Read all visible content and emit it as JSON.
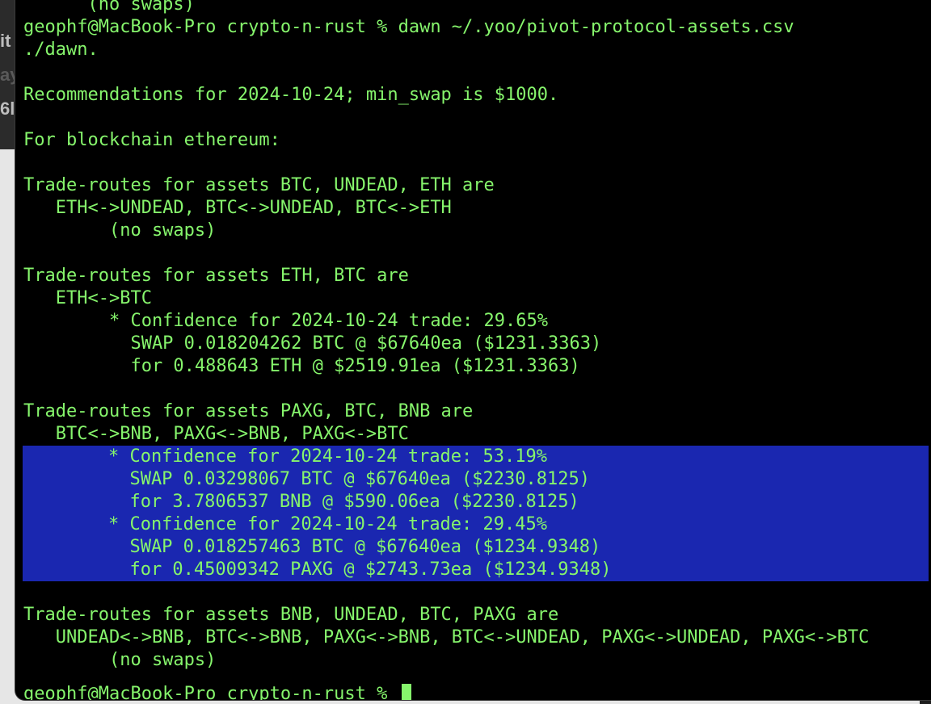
{
  "background": {
    "fragments": [
      "it",
      "ay",
      "6l"
    ],
    "colors": {
      "desktop": "#e6e6e6",
      "dark_strip": "#2b2b2b"
    }
  },
  "terminal": {
    "colors": {
      "background": "#000000",
      "text": "#86f56c",
      "selection": "#1a27b0"
    },
    "prompt": "geophf@MacBook-Pro crypto-n-rust % ",
    "lines": [
      {
        "text": "      (no swaps)",
        "highlighted": false
      },
      {
        "text": "geophf@MacBook-Pro crypto-n-rust % dawn ~/.yoo/pivot-protocol-assets.csv",
        "highlighted": false
      },
      {
        "text": "./dawn.",
        "highlighted": false
      },
      {
        "text": "",
        "highlighted": false
      },
      {
        "text": "Recommendations for 2024-10-24; min_swap is $1000.",
        "highlighted": false
      },
      {
        "text": "",
        "highlighted": false
      },
      {
        "text": "For blockchain ethereum:",
        "highlighted": false
      },
      {
        "text": "",
        "highlighted": false
      },
      {
        "text": "Trade-routes for assets BTC, UNDEAD, ETH are",
        "highlighted": false
      },
      {
        "text": "   ETH<->UNDEAD, BTC<->UNDEAD, BTC<->ETH",
        "highlighted": false
      },
      {
        "text": "        (no swaps)",
        "highlighted": false
      },
      {
        "text": "",
        "highlighted": false
      },
      {
        "text": "Trade-routes for assets ETH, BTC are",
        "highlighted": false
      },
      {
        "text": "   ETH<->BTC",
        "highlighted": false
      },
      {
        "text": "        * Confidence for 2024-10-24 trade: 29.65%",
        "highlighted": false
      },
      {
        "text": "          SWAP 0.018204262 BTC @ $67640ea ($1231.3363)",
        "highlighted": false
      },
      {
        "text": "          for 0.488643 ETH @ $2519.91ea ($1231.3363)",
        "highlighted": false
      },
      {
        "text": "",
        "highlighted": false
      },
      {
        "text": "Trade-routes for assets PAXG, BTC, BNB are",
        "highlighted": false
      },
      {
        "text": "   BTC<->BNB, PAXG<->BNB, PAXG<->BTC",
        "highlighted": false
      },
      {
        "text": "        * Confidence for 2024-10-24 trade: 53.19%",
        "highlighted": true
      },
      {
        "text": "          SWAP 0.03298067 BTC @ $67640ea ($2230.8125)",
        "highlighted": true
      },
      {
        "text": "          for 3.7806537 BNB @ $590.06ea ($2230.8125)",
        "highlighted": true
      },
      {
        "text": "        * Confidence for 2024-10-24 trade: 29.45%",
        "highlighted": true
      },
      {
        "text": "          SWAP 0.018257463 BTC @ $67640ea ($1234.9348)",
        "highlighted": true
      },
      {
        "text": "          for 0.45009342 PAXG @ $2743.73ea ($1234.9348)",
        "highlighted": true
      },
      {
        "text": "",
        "highlighted": false
      },
      {
        "text": "Trade-routes for assets BNB, UNDEAD, BTC, PAXG are",
        "highlighted": false
      },
      {
        "text": "   UNDEAD<->BNB, BTC<->BNB, PAXG<->BNB, BTC<->UNDEAD, PAXG<->UNDEAD, PAXG<->BTC",
        "highlighted": false
      },
      {
        "text": "        (no swaps)",
        "highlighted": false
      }
    ]
  }
}
